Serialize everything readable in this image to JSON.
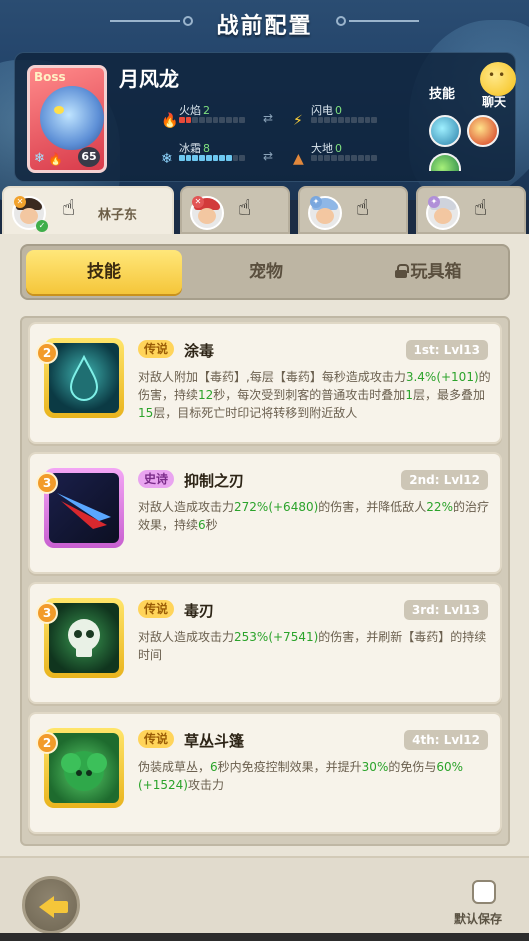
{
  "screen": {
    "title": "战前配置"
  },
  "boss": {
    "tag": "Boss",
    "name": "月风龙",
    "level": "65",
    "stats": [
      {
        "label": "火焰",
        "value": "2",
        "filled": 2
      },
      {
        "label": "闪电",
        "value": "0",
        "filled": 0
      },
      {
        "label": "冰霜",
        "value": "8",
        "filled": 8
      },
      {
        "label": "大地",
        "value": "0",
        "filled": 0
      }
    ],
    "skills_label": "技能",
    "chat_label": "聊天"
  },
  "players": [
    {
      "name": "林子东",
      "active": true
    },
    {
      "name": "",
      "active": false
    },
    {
      "name": "",
      "active": false
    },
    {
      "name": "",
      "active": false
    }
  ],
  "tabs": {
    "skills": "技能",
    "pets": "宠物",
    "toybox": "玩具箱"
  },
  "skills": [
    {
      "badge": "2",
      "rarity": "传说",
      "name": "涂毒",
      "level": "1st: Lvl13",
      "desc": "对敌人附加【毒药】,每层【毒药】每秒造成攻击力3.4%(+101)的伤害，持续12秒，每次受到刺客的普通攻击时叠加1层，最多叠加15层，目标死亡时印记将转移到附近敌人"
    },
    {
      "badge": "3",
      "rarity": "史诗",
      "name": "抑制之刃",
      "level": "2nd: Lvl12",
      "desc": "对敌人造成攻击力272%(+6480)的伤害，并降低敌人22%的治疗效果，持续6秒"
    },
    {
      "badge": "3",
      "rarity": "传说",
      "name": "毒刃",
      "level": "3rd: Lvl13",
      "desc": "对敌人造成攻击力253%(+7541)的伤害，并刷新【毒药】的持续时间"
    },
    {
      "badge": "2",
      "rarity": "传说",
      "name": "草丛斗篷",
      "level": "4th: Lvl12",
      "desc": "伪装成草丛，6秒内免疫控制效果，并提升30%的免伤与60%(+1524)攻击力"
    }
  ],
  "footer": {
    "save_label": "默认保存"
  },
  "colors": {
    "accent_yellow": "#f5c63a",
    "legend": "#ffd45a",
    "epic": "#e9a4f0",
    "green_value": "#2ba32b"
  }
}
